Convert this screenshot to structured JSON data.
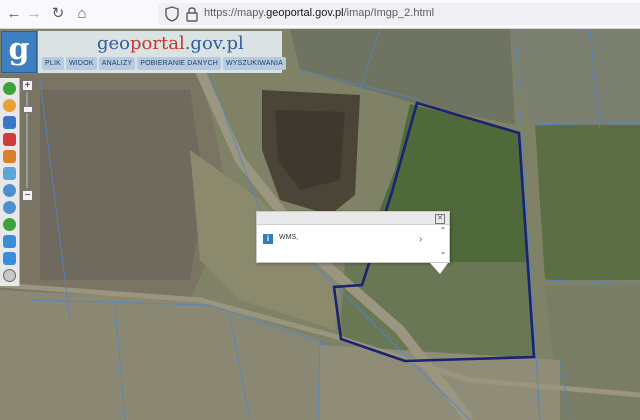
{
  "browser": {
    "url_host_pre": "https://mapy.",
    "url_host_bold": "geoportal.gov.pl",
    "url_path": "/imap/Imgp_2.html",
    "nav": {
      "back": "←",
      "forward": "→",
      "reload": "↻",
      "home": "⌂"
    }
  },
  "header": {
    "logo_letter": "g",
    "brand": {
      "geo": "geo",
      "portal": "portal",
      "domain": ".gov.pl"
    },
    "menu": [
      "PLIK",
      "WIDOK",
      "ANALIZY",
      "POBIERANIE DANYCH",
      "WYSZUKIWANIA"
    ]
  },
  "zoom": {
    "plus": "+",
    "minus": "−"
  },
  "popup": {
    "close": "✕",
    "info_glyph": "i",
    "label": "WMS,",
    "arrow": "›",
    "scroll_up": "⌃",
    "scroll_down": "⌄"
  },
  "colors": {
    "parcel_border": "#1b2270",
    "brand_blue": "#2f5e9a",
    "brand_red": "#c0392b",
    "logo_bg": "#3f7fbf"
  }
}
